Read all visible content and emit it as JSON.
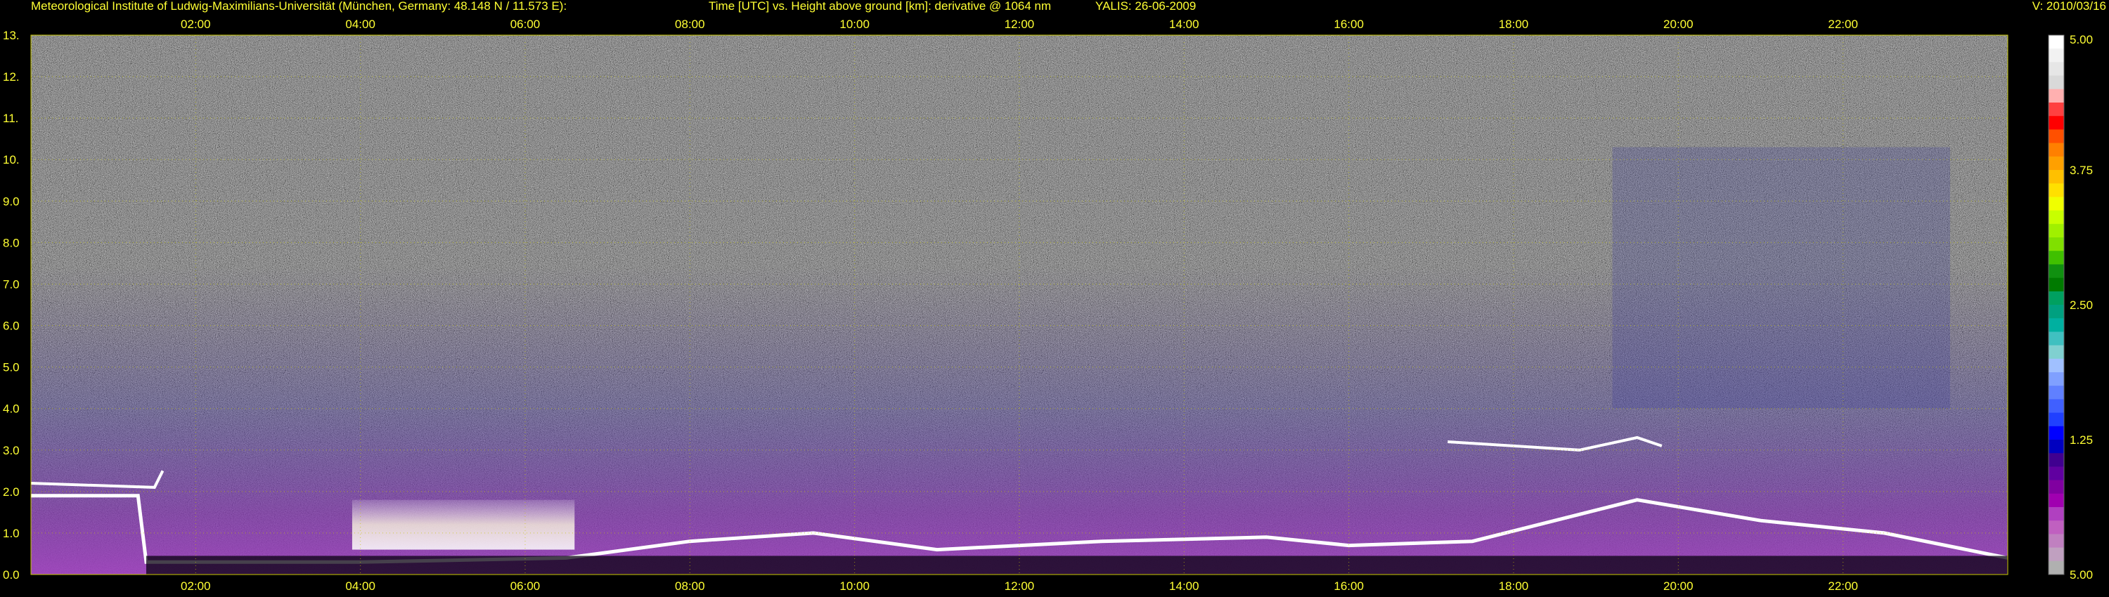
{
  "header": {
    "institute": "Meteorological Institute of Ludwig-Maximilians-Universität (München, Germany: 48.148 N / 11.573 E):",
    "plot_title": "Time [UTC] vs. Height above ground [km]: derivative @ 1064 nm",
    "instrument": "YALIS: 26-06-2009",
    "version": "V: 2010/03/16"
  },
  "colors": {
    "text": "#ffff33",
    "grid": "#c8c800",
    "background": "#000000"
  },
  "chart_data": {
    "type": "heatmap",
    "title": "Time [UTC] vs. Height above ground [km]: derivative @ 1064 nm",
    "xlabel": "Time [UTC]",
    "ylabel": "Height above ground [km]",
    "xlim": [
      0,
      24
    ],
    "ylim": [
      0,
      13
    ],
    "x_ticks": [
      {
        "value": 2,
        "label": "02:00"
      },
      {
        "value": 4,
        "label": "04:00"
      },
      {
        "value": 6,
        "label": "06:00"
      },
      {
        "value": 8,
        "label": "08:00"
      },
      {
        "value": 10,
        "label": "10:00"
      },
      {
        "value": 12,
        "label": "12:00"
      },
      {
        "value": 14,
        "label": "14:00"
      },
      {
        "value": 16,
        "label": "16:00"
      },
      {
        "value": 18,
        "label": "18:00"
      },
      {
        "value": 20,
        "label": "20:00"
      },
      {
        "value": 22,
        "label": "22:00"
      }
    ],
    "y_ticks": [
      {
        "value": 0,
        "label": "0.0"
      },
      {
        "value": 1,
        "label": "1.0"
      },
      {
        "value": 2,
        "label": "2.0"
      },
      {
        "value": 3,
        "label": "3.0"
      },
      {
        "value": 4,
        "label": "4.0"
      },
      {
        "value": 5,
        "label": "5.0"
      },
      {
        "value": 6,
        "label": "6.0"
      },
      {
        "value": 7,
        "label": "7.0"
      },
      {
        "value": 8,
        "label": "8.0"
      },
      {
        "value": 9,
        "label": "9.0"
      },
      {
        "value": 10,
        "label": "10."
      },
      {
        "value": 11,
        "label": "11."
      },
      {
        "value": 12,
        "label": "12."
      },
      {
        "value": 13,
        "label": "13."
      }
    ],
    "grid": true,
    "colorbar": {
      "min": -5.0,
      "max": 5.0,
      "tick_labels": [
        {
          "value": 5.0,
          "label": "5.00"
        },
        {
          "value": 3.75,
          "label": "3.75"
        },
        {
          "value": 2.5,
          "label": "2.50"
        },
        {
          "value": 1.25,
          "label": "1.25"
        },
        {
          "value": -5.0,
          "label": "5.00"
        }
      ],
      "colors_top_to_bottom": [
        "#ffffff",
        "#f2f2f2",
        "#e6e6e6",
        "#d9d9d9",
        "#ffb0b0",
        "#ff4040",
        "#ff0000",
        "#ff5000",
        "#ff8000",
        "#ffa000",
        "#ffc000",
        "#ffe000",
        "#f0ff00",
        "#c8ff00",
        "#a0f000",
        "#80e000",
        "#40c000",
        "#109010",
        "#007a00",
        "#00a060",
        "#00a080",
        "#00b0a0",
        "#40c0c0",
        "#80d0d0",
        "#a0c0ff",
        "#80a0ff",
        "#6080ff",
        "#4060ff",
        "#2040ff",
        "#0000ff",
        "#0000c0",
        "#400090",
        "#6000a0",
        "#8000a0",
        "#a000b0",
        "#b040c0",
        "#c060c0",
        "#c080c0",
        "#c0a0c0",
        "#b0b0b0"
      ]
    },
    "features": [
      {
        "name": "morning_fog_layer",
        "t_start": 3.9,
        "t_end": 6.6,
        "h_low": 0.6,
        "h_high": 1.8
      },
      {
        "name": "boundary_layer_top",
        "points": [
          [
            0.0,
            1.9
          ],
          [
            1.3,
            1.9
          ],
          [
            1.4,
            0.3
          ],
          [
            4.0,
            0.3
          ],
          [
            6.5,
            0.4
          ],
          [
            8.0,
            0.8
          ],
          [
            9.5,
            1.0
          ],
          [
            11.0,
            0.6
          ],
          [
            13.0,
            0.8
          ],
          [
            15.0,
            0.9
          ],
          [
            16.0,
            0.7
          ],
          [
            17.5,
            0.8
          ],
          [
            19.5,
            1.8
          ],
          [
            21.0,
            1.3
          ],
          [
            22.5,
            1.0
          ],
          [
            24.0,
            0.4
          ]
        ]
      },
      {
        "name": "residual_layer",
        "points": [
          [
            0.0,
            2.2
          ],
          [
            1.5,
            2.1
          ],
          [
            1.6,
            2.5
          ]
        ]
      },
      {
        "name": "cloud_layer_midlevel",
        "points": [
          [
            17.2,
            3.2
          ],
          [
            18.0,
            3.1
          ],
          [
            18.8,
            3.0
          ],
          [
            19.5,
            3.3
          ],
          [
            19.8,
            3.1
          ]
        ]
      },
      {
        "name": "cirrus_fallstreaks",
        "t_start": 19.2,
        "t_end": 23.3,
        "h_low": 4.0,
        "h_high": 10.3
      }
    ]
  }
}
